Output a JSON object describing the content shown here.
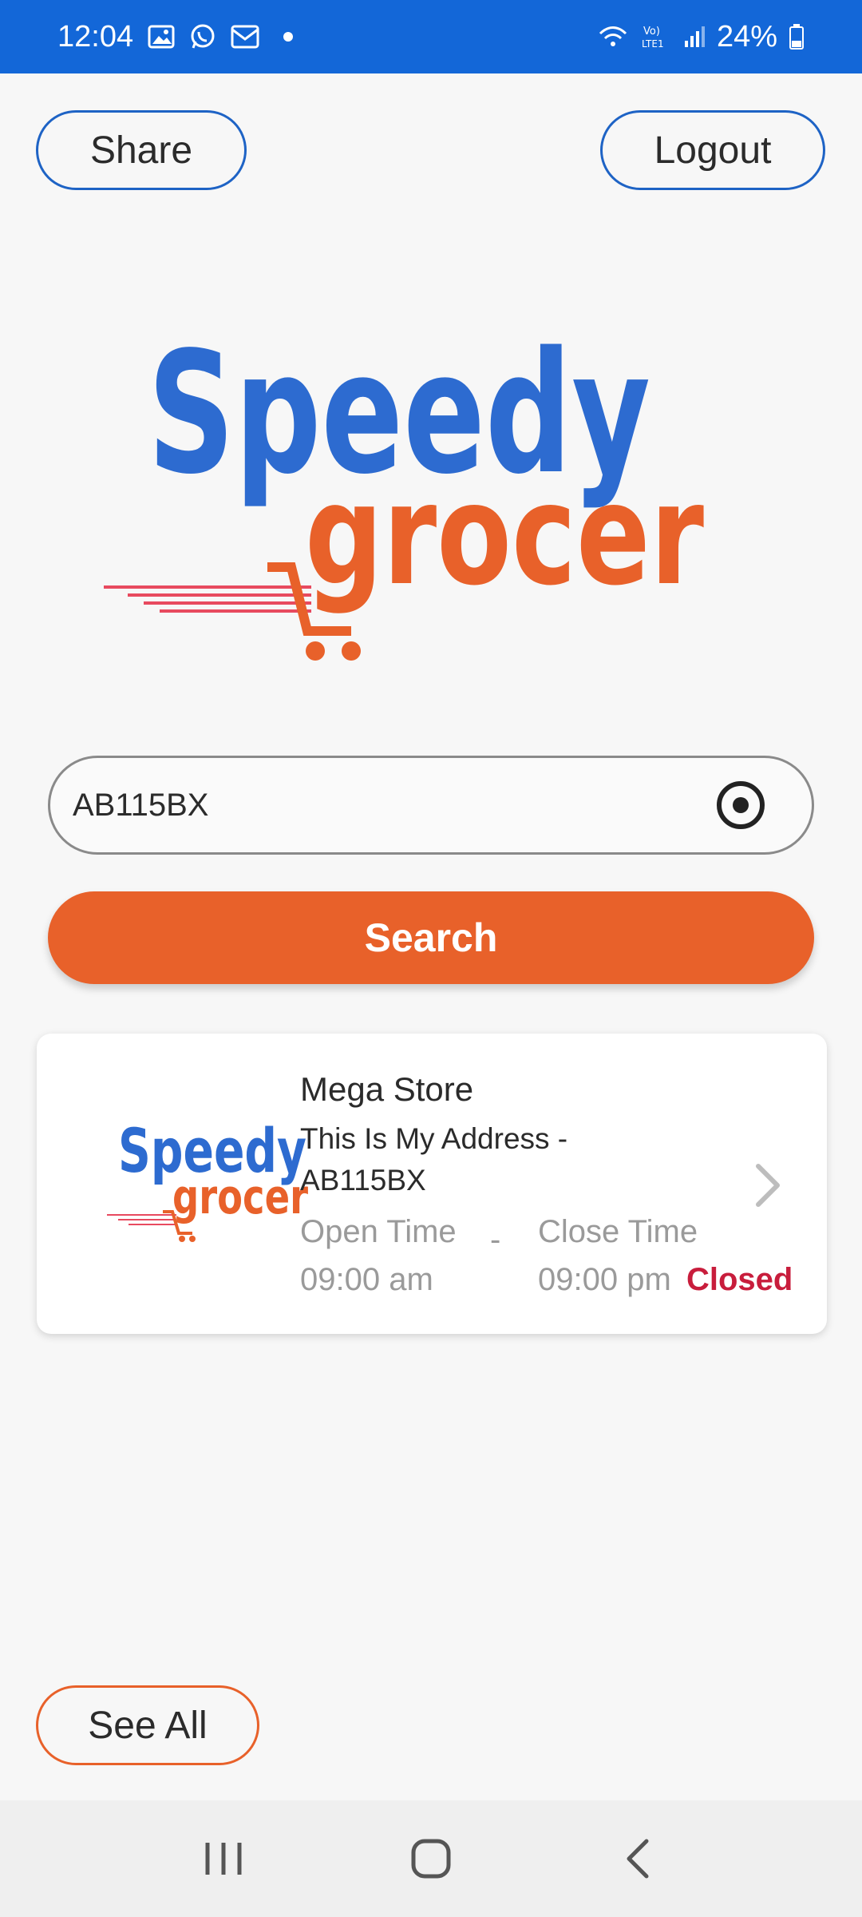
{
  "status_bar": {
    "time": "12:04",
    "battery": "24%",
    "icons": [
      "gallery-icon",
      "whatsapp-icon",
      "mail-icon",
      "wifi-icon",
      "volte-icon",
      "signal-icon",
      "battery-icon"
    ]
  },
  "header": {
    "share_label": "Share",
    "logout_label": "Logout"
  },
  "logo": {
    "brand_top": "Speedy",
    "brand_bottom": "grocer"
  },
  "search": {
    "value": "AB115BX",
    "button_label": "Search"
  },
  "store": {
    "name": "Mega Store",
    "address": "This Is My Address - AB115BX",
    "open_label": "Open Time",
    "open_value": "09:00 am",
    "dash": "-",
    "close_label": "Close Time",
    "close_value": "09:00 pm",
    "status": "Closed"
  },
  "footer": {
    "see_all_label": "See All"
  },
  "colors": {
    "status_bar": "#1367d8",
    "accent_orange": "#e8612a",
    "brand_blue": "#2d6bd0",
    "closed_red": "#c81d3c"
  }
}
